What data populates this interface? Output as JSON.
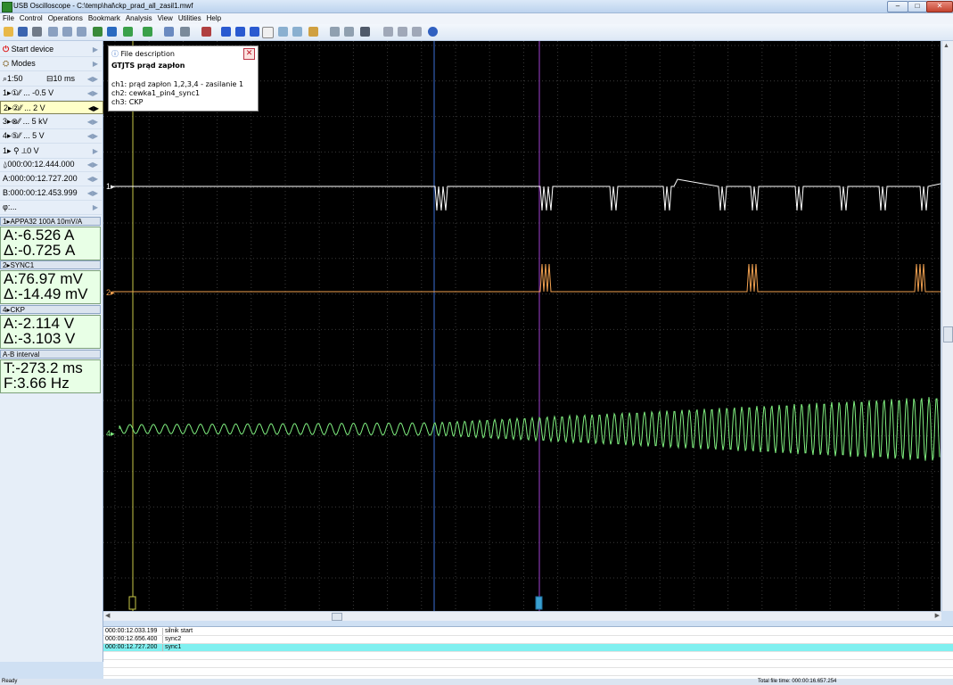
{
  "window": {
    "title": "USB Oscilloscope - C:\\temp\\hal\\ckp_prad_all_zasil1.mwf",
    "minimize": "–",
    "restore": "□",
    "close": "✕"
  },
  "menu": [
    "File",
    "Control",
    "Operations",
    "Bookmark",
    "Analysis",
    "View",
    "Utilities",
    "Help"
  ],
  "sidebar": {
    "start_device": "Start device",
    "modes": "Modes",
    "timebase": {
      "zoom": "1:50",
      "time": "10 ms"
    },
    "channels": [
      {
        "label": "1▸①⁄⁄ ... -0.5 V"
      },
      {
        "label": "2▸②⁄⁄ ... 2 V"
      },
      {
        "label": "3▸⊗⁄⁄ ... 5 kV"
      },
      {
        "label": "4▸⑤⁄⁄ ... 5 V"
      }
    ],
    "trigger": "1▸ ⚲ ⟂0 V",
    "trigger_time": "000:00:12.444.000",
    "cursor_a": "A:000:00:12.727.200",
    "cursor_b": "B:000:00:12.453.999",
    "phi": "φ:..."
  },
  "measure_panels": [
    {
      "header": "1▸APPA32 100A 10mV/A",
      "a": "A:-6.526 A",
      "d": "Δ:-0.725 A"
    },
    {
      "header": "2▸SYNC1",
      "a": "A:76.97 mV",
      "d": "Δ:-14.49 mV"
    },
    {
      "header": "4▸CKP",
      "a": "A:-2.114 V",
      "d": "Δ:-3.103 V"
    },
    {
      "header": "A-B interval",
      "a": "T:-273.2 ms",
      "d": "F:3.66 Hz"
    }
  ],
  "file_description": {
    "header": "File description",
    "title": "GTJTS prąd zapłon",
    "ch1": "ch1: prąd zapłon 1,2,3,4 - zasilanie 1",
    "ch2": "ch2: cewka1_pin4_sync1",
    "ch3": "ch3: CKP"
  },
  "scope": {
    "markers": [
      "1▸",
      "2▸",
      "4▸"
    ],
    "colors": {
      "ch1": "#ffffff",
      "ch2": "#f0a050",
      "ch4": "#80f080",
      "grid": "#3a3a3a"
    }
  },
  "events": [
    {
      "time": "000:00:12.033.199",
      "name": "silnik start"
    },
    {
      "time": "000:00:12.656.400",
      "name": "sync2"
    },
    {
      "time": "000:00:12.727.200",
      "name": "sync1"
    }
  ],
  "status": {
    "left": "Ready",
    "right": "Total file time: 000:00:16.657.254"
  }
}
